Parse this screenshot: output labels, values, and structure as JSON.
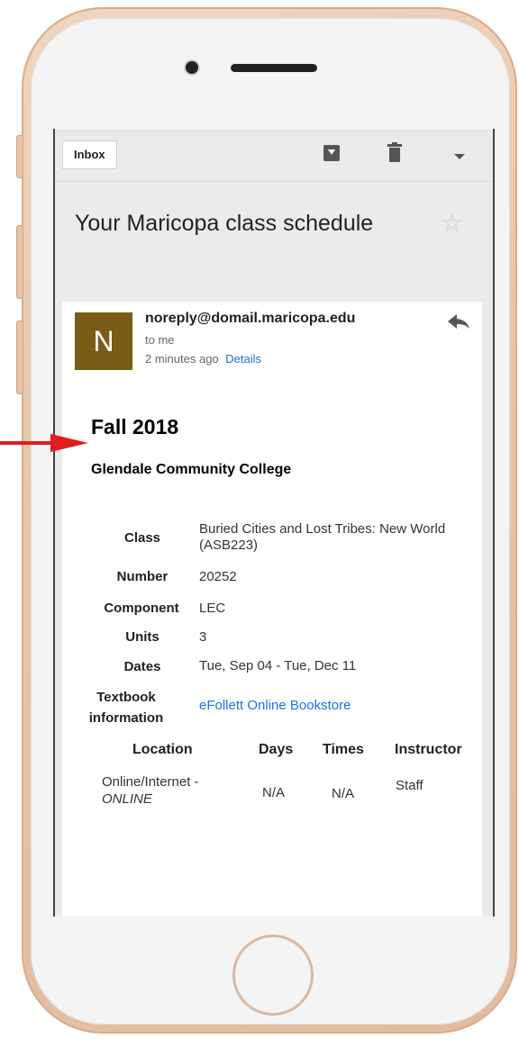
{
  "toolbar": {
    "inbox_label": "Inbox",
    "archive_icon": "archive-icon",
    "trash_icon": "trash-icon",
    "more_icon": "chevron-down-icon"
  },
  "email": {
    "subject": "Your Maricopa class schedule",
    "avatar_letter": "N",
    "avatar_color": "#7a5c16",
    "from": "noreply@domail.maricopa.edu",
    "to": "to me",
    "time": "2 minutes ago",
    "details_link": "Details"
  },
  "schedule": {
    "term": "Fall 2018",
    "college": "Glendale Community College",
    "rows": [
      {
        "label": "Class",
        "value": "Buried Cities and Lost Tribes: New World (ASB223)"
      },
      {
        "label": "Number",
        "value": "20252"
      },
      {
        "label": "Component",
        "value": "LEC"
      },
      {
        "label": "Units",
        "value": "3"
      },
      {
        "label": "Dates",
        "value": "Tue, Sep 04 - Tue, Dec 11"
      },
      {
        "label": "Textbook information",
        "value": "eFollett Online Bookstore"
      }
    ],
    "table_headers": {
      "location": "Location",
      "days": "Days",
      "times": "Times",
      "instructor": "Instructor"
    },
    "table_row": {
      "location": "Online/Internet -",
      "location_sub": "ONLINE",
      "days": "N/A",
      "times": "N/A",
      "instructor": "Staff"
    }
  },
  "colors": {
    "accent_link": "#1a73e8",
    "arrow": "#e41b1b",
    "frame": "#e9c6ab"
  }
}
